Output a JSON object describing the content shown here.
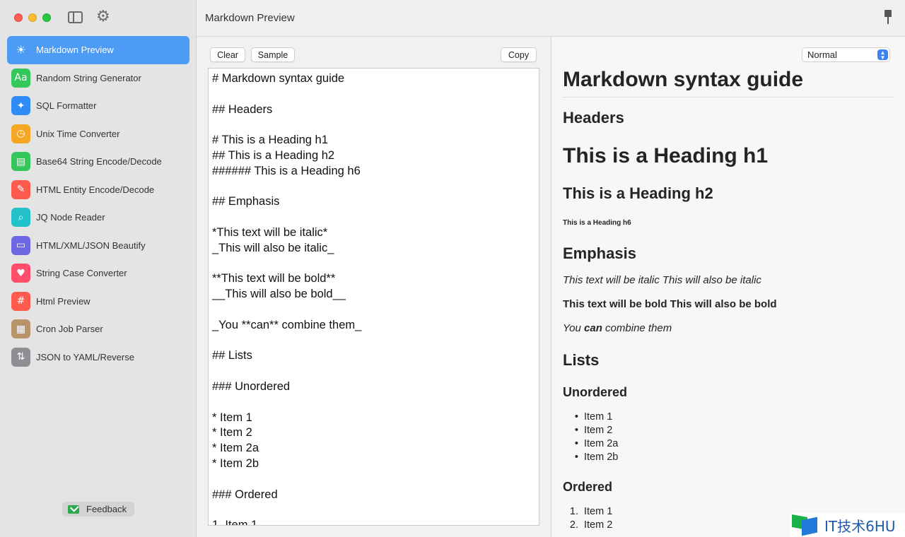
{
  "window": {
    "title": "Markdown Preview"
  },
  "sidebar": {
    "items": [
      {
        "label": "Markdown Preview",
        "icon": "sun-icon",
        "glyph": "☀",
        "color": "#4c9bf5"
      },
      {
        "label": "Random String Generator",
        "icon": "text-aa-icon",
        "glyph": "Aa",
        "color": "#34c759"
      },
      {
        "label": "SQL Formatter",
        "icon": "magic-wand-icon",
        "glyph": "✦",
        "color": "#2f8cf7"
      },
      {
        "label": "Unix Time Converter",
        "icon": "clock-icon",
        "glyph": "◷",
        "color": "#f5a623"
      },
      {
        "label": "Base64 String Encode/Decode",
        "icon": "message-icon",
        "glyph": "▤",
        "color": "#34c759"
      },
      {
        "label": "HTML Entity Encode/Decode",
        "icon": "feather-icon",
        "glyph": "✎",
        "color": "#ff5a4e"
      },
      {
        "label": "JQ Node Reader",
        "icon": "magnifier-icon",
        "glyph": "⌕",
        "color": "#22c0c9"
      },
      {
        "label": "HTML/XML/JSON Beautify",
        "icon": "laptop-icon",
        "glyph": "▭",
        "color": "#6d67e4"
      },
      {
        "label": "String Case Converter",
        "icon": "heart-icon",
        "glyph": "♥",
        "color": "#ff4d6a"
      },
      {
        "label": "Html Preview",
        "icon": "hash-icon",
        "glyph": "#",
        "color": "#ff5a4e"
      },
      {
        "label": "Cron Job Parser",
        "icon": "grid-icon",
        "glyph": "▦",
        "color": "#b8946a"
      },
      {
        "label": "JSON to YAML/Reverse",
        "icon": "swap-icon",
        "glyph": "⇅",
        "color": "#8e8e93"
      }
    ],
    "feedback_label": "Feedback"
  },
  "editor": {
    "clear_label": "Clear",
    "sample_label": "Sample",
    "copy_label": "Copy",
    "content": "# Markdown syntax guide\n\n## Headers\n\n# This is a Heading h1\n## This is a Heading h2\n###### This is a Heading h6\n\n## Emphasis\n\n*This text will be italic*\n_This will also be italic_\n\n**This text will be bold**\n__This will also be bold__\n\n_You **can** combine them_\n\n## Lists\n\n### Unordered\n\n* Item 1\n* Item 2\n* Item 2a\n* Item 2b\n\n### Ordered\n\n1. Item 1"
  },
  "preview": {
    "mode_selected": "Normal",
    "h1_guide": "Markdown syntax guide",
    "h2_headers": "Headers",
    "h1_sample": "This is a Heading h1",
    "h2_sample": "This is a Heading h2",
    "h6_sample": "This is a Heading h6",
    "h2_emphasis": "Emphasis",
    "italic_line": "This text will be italic This will also be italic",
    "bold_line": "This text will be bold This will also be bold",
    "combine_you": "You ",
    "combine_can": "can",
    "combine_rest": " combine them",
    "h2_lists": "Lists",
    "h3_unordered": "Unordered",
    "unordered": [
      "Item 1",
      "Item 2",
      "Item 2a",
      "Item 2b"
    ],
    "h3_ordered": "Ordered",
    "ordered": [
      {
        "marker": "1.",
        "text": "Item 1"
      },
      {
        "marker": "2.",
        "text": "Item 2"
      }
    ]
  },
  "watermark": {
    "text": "IT技术6HU"
  }
}
